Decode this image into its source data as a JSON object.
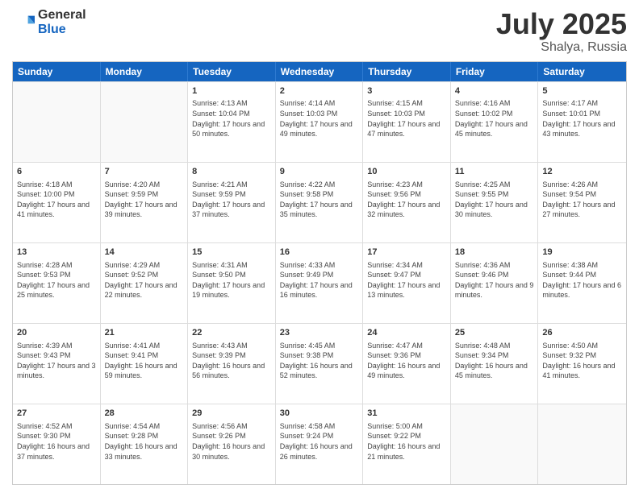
{
  "header": {
    "logo_general": "General",
    "logo_blue": "Blue",
    "title": "July 2025",
    "location": "Shalya, Russia"
  },
  "days": [
    "Sunday",
    "Monday",
    "Tuesday",
    "Wednesday",
    "Thursday",
    "Friday",
    "Saturday"
  ],
  "weeks": [
    [
      {
        "day": "",
        "info": ""
      },
      {
        "day": "",
        "info": ""
      },
      {
        "day": "1",
        "info": "Sunrise: 4:13 AM\nSunset: 10:04 PM\nDaylight: 17 hours\nand 50 minutes."
      },
      {
        "day": "2",
        "info": "Sunrise: 4:14 AM\nSunset: 10:03 PM\nDaylight: 17 hours\nand 49 minutes."
      },
      {
        "day": "3",
        "info": "Sunrise: 4:15 AM\nSunset: 10:03 PM\nDaylight: 17 hours\nand 47 minutes."
      },
      {
        "day": "4",
        "info": "Sunrise: 4:16 AM\nSunset: 10:02 PM\nDaylight: 17 hours\nand 45 minutes."
      },
      {
        "day": "5",
        "info": "Sunrise: 4:17 AM\nSunset: 10:01 PM\nDaylight: 17 hours\nand 43 minutes."
      }
    ],
    [
      {
        "day": "6",
        "info": "Sunrise: 4:18 AM\nSunset: 10:00 PM\nDaylight: 17 hours\nand 41 minutes."
      },
      {
        "day": "7",
        "info": "Sunrise: 4:20 AM\nSunset: 9:59 PM\nDaylight: 17 hours\nand 39 minutes."
      },
      {
        "day": "8",
        "info": "Sunrise: 4:21 AM\nSunset: 9:59 PM\nDaylight: 17 hours\nand 37 minutes."
      },
      {
        "day": "9",
        "info": "Sunrise: 4:22 AM\nSunset: 9:58 PM\nDaylight: 17 hours\nand 35 minutes."
      },
      {
        "day": "10",
        "info": "Sunrise: 4:23 AM\nSunset: 9:56 PM\nDaylight: 17 hours\nand 32 minutes."
      },
      {
        "day": "11",
        "info": "Sunrise: 4:25 AM\nSunset: 9:55 PM\nDaylight: 17 hours\nand 30 minutes."
      },
      {
        "day": "12",
        "info": "Sunrise: 4:26 AM\nSunset: 9:54 PM\nDaylight: 17 hours\nand 27 minutes."
      }
    ],
    [
      {
        "day": "13",
        "info": "Sunrise: 4:28 AM\nSunset: 9:53 PM\nDaylight: 17 hours\nand 25 minutes."
      },
      {
        "day": "14",
        "info": "Sunrise: 4:29 AM\nSunset: 9:52 PM\nDaylight: 17 hours\nand 22 minutes."
      },
      {
        "day": "15",
        "info": "Sunrise: 4:31 AM\nSunset: 9:50 PM\nDaylight: 17 hours\nand 19 minutes."
      },
      {
        "day": "16",
        "info": "Sunrise: 4:33 AM\nSunset: 9:49 PM\nDaylight: 17 hours\nand 16 minutes."
      },
      {
        "day": "17",
        "info": "Sunrise: 4:34 AM\nSunset: 9:47 PM\nDaylight: 17 hours\nand 13 minutes."
      },
      {
        "day": "18",
        "info": "Sunrise: 4:36 AM\nSunset: 9:46 PM\nDaylight: 17 hours\nand 9 minutes."
      },
      {
        "day": "19",
        "info": "Sunrise: 4:38 AM\nSunset: 9:44 PM\nDaylight: 17 hours\nand 6 minutes."
      }
    ],
    [
      {
        "day": "20",
        "info": "Sunrise: 4:39 AM\nSunset: 9:43 PM\nDaylight: 17 hours\nand 3 minutes."
      },
      {
        "day": "21",
        "info": "Sunrise: 4:41 AM\nSunset: 9:41 PM\nDaylight: 16 hours\nand 59 minutes."
      },
      {
        "day": "22",
        "info": "Sunrise: 4:43 AM\nSunset: 9:39 PM\nDaylight: 16 hours\nand 56 minutes."
      },
      {
        "day": "23",
        "info": "Sunrise: 4:45 AM\nSunset: 9:38 PM\nDaylight: 16 hours\nand 52 minutes."
      },
      {
        "day": "24",
        "info": "Sunrise: 4:47 AM\nSunset: 9:36 PM\nDaylight: 16 hours\nand 49 minutes."
      },
      {
        "day": "25",
        "info": "Sunrise: 4:48 AM\nSunset: 9:34 PM\nDaylight: 16 hours\nand 45 minutes."
      },
      {
        "day": "26",
        "info": "Sunrise: 4:50 AM\nSunset: 9:32 PM\nDaylight: 16 hours\nand 41 minutes."
      }
    ],
    [
      {
        "day": "27",
        "info": "Sunrise: 4:52 AM\nSunset: 9:30 PM\nDaylight: 16 hours\nand 37 minutes."
      },
      {
        "day": "28",
        "info": "Sunrise: 4:54 AM\nSunset: 9:28 PM\nDaylight: 16 hours\nand 33 minutes."
      },
      {
        "day": "29",
        "info": "Sunrise: 4:56 AM\nSunset: 9:26 PM\nDaylight: 16 hours\nand 30 minutes."
      },
      {
        "day": "30",
        "info": "Sunrise: 4:58 AM\nSunset: 9:24 PM\nDaylight: 16 hours\nand 26 minutes."
      },
      {
        "day": "31",
        "info": "Sunrise: 5:00 AM\nSunset: 9:22 PM\nDaylight: 16 hours\nand 21 minutes."
      },
      {
        "day": "",
        "info": ""
      },
      {
        "day": "",
        "info": ""
      }
    ]
  ]
}
